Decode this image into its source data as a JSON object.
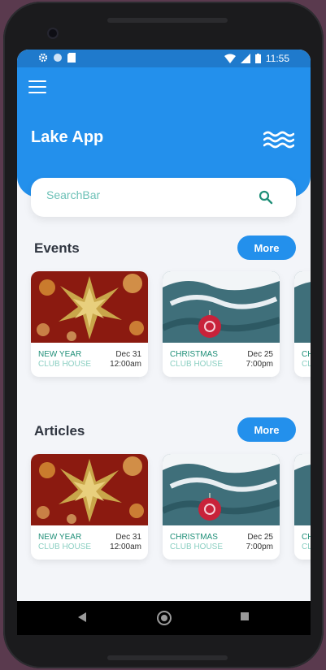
{
  "status": {
    "time": "11:55"
  },
  "app": {
    "title": "Lake App"
  },
  "search": {
    "placeholder": "SearchBar"
  },
  "sections": [
    {
      "title": "Events",
      "more_label": "More",
      "cards": [
        {
          "title": "NEW YEAR",
          "subtitle": "CLUB HOUSE",
          "date": "Dec 31",
          "time": "12:00am"
        },
        {
          "title": "CHRISTMAS",
          "subtitle": "CLUB HOUSE",
          "date": "Dec 25",
          "time": "7:00pm"
        },
        {
          "title": "CH",
          "subtitle": "CL",
          "date": "",
          "time": ""
        }
      ]
    },
    {
      "title": "Articles",
      "more_label": "More",
      "cards": [
        {
          "title": "NEW YEAR",
          "subtitle": "CLUB HOUSE",
          "date": "Dec 31",
          "time": "12:00am"
        },
        {
          "title": "CHRISTMAS",
          "subtitle": "CLUB HOUSE",
          "date": "Dec 25",
          "time": "7:00pm"
        },
        {
          "title": "CH",
          "subtitle": "CL",
          "date": "",
          "time": ""
        }
      ]
    }
  ],
  "colors": {
    "primary": "#2390ec",
    "accent": "#1f8f78",
    "statusbar": "#1f7acc"
  },
  "icons": {
    "menu": "menu-icon",
    "logo": "waves-icon",
    "search": "search-icon"
  }
}
